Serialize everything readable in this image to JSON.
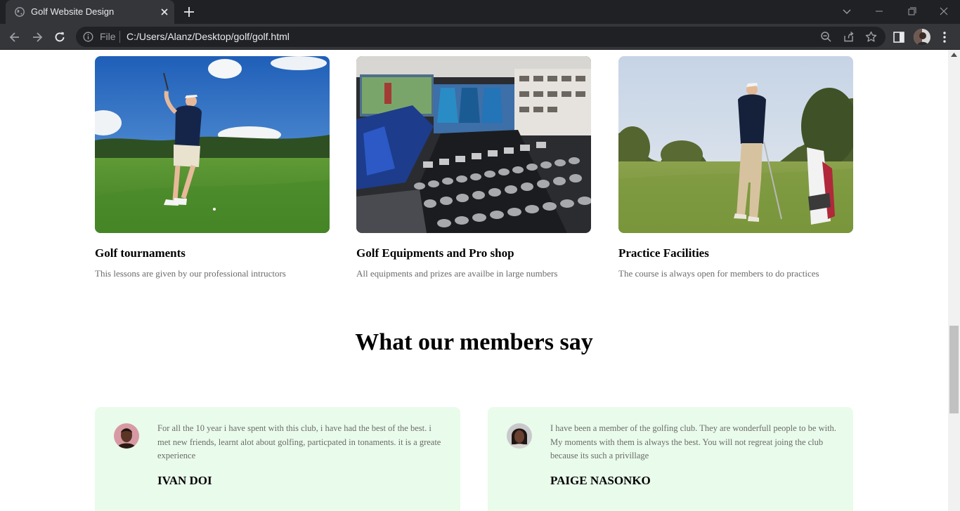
{
  "browser": {
    "tab_title": "Golf Website Design",
    "scheme_label": "File",
    "url": "C:/Users/Alanz/Desktop/golf/golf.html"
  },
  "services": [
    {
      "title": "Golf tournaments",
      "description": "This lessons are given by our professional intructors"
    },
    {
      "title": "Golf Equipments and Pro shop",
      "description": "All equipments and prizes are availbe in large numbers"
    },
    {
      "title": "Practice Facilities",
      "description": "The course is always open for members to do practices"
    }
  ],
  "testimonials_heading": "What our members say",
  "testimonials": [
    {
      "text": "For all the 10 year i have spent with this club, i have had the best of the best. i met new friends, learnt alot about golfing, particpated in tonaments. it is a greate experience",
      "name": "IVAN DOI"
    },
    {
      "text": "I have been a member of the golfing club. They are wonderfull people to be with. My moments with them is always the best. You will not regreat joing the club because its such a privillage",
      "name": "PAIGE NASONKO"
    }
  ],
  "colors": {
    "chrome_dark": "#202124",
    "chrome_tab": "#35363a",
    "testimonial_bg": "#e9fbea",
    "muted_text": "#6b6b6b"
  },
  "icons": [
    "globe-icon",
    "close-icon",
    "plus-icon",
    "chevron-down-icon",
    "minimize-icon",
    "maximize-icon",
    "window-close-icon",
    "back-arrow-icon",
    "forward-arrow-icon",
    "reload-icon",
    "info-icon",
    "zoom-icon",
    "share-icon",
    "star-icon",
    "side-panel-icon",
    "kebab-menu-icon"
  ]
}
